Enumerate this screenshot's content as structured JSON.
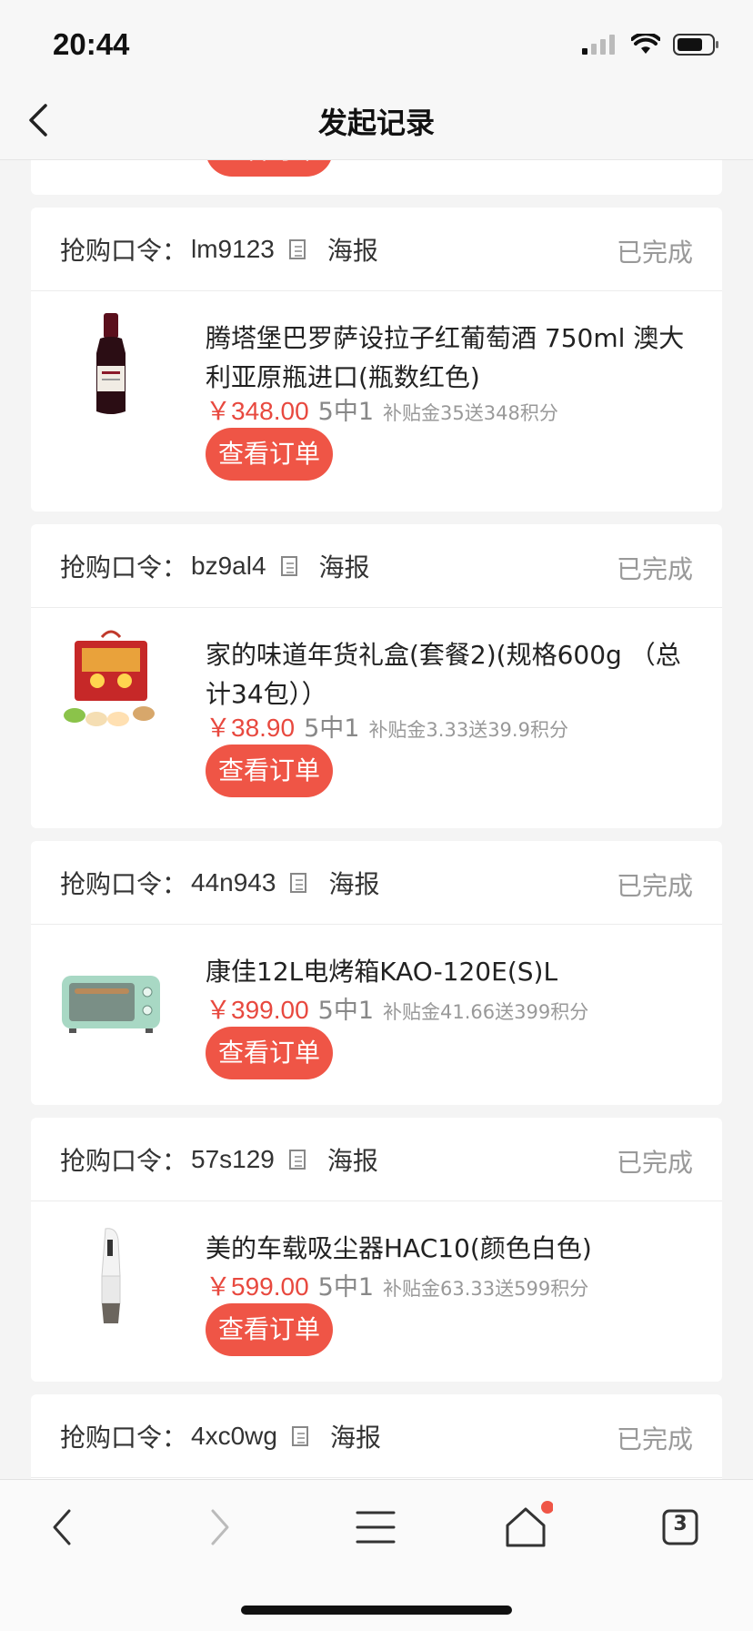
{
  "status_bar": {
    "time": "20:44"
  },
  "nav": {
    "title": "发起记录"
  },
  "common": {
    "code_label": "抢购口令：",
    "poster_label": "海报",
    "order_button": "查看订单"
  },
  "orders": [
    {
      "code": "lm9123",
      "status": "已完成",
      "title": "腾塔堡巴罗萨设拉子红葡萄酒 750ml 澳大利亚原瓶进口(瓶数红色)",
      "price": "￥348.00",
      "odds": "5中1",
      "reward": "补贴金35送348积分",
      "image": "wine-bottle-image"
    },
    {
      "code": "bz9al4",
      "status": "已完成",
      "title": "家的味道年货礼盒(套餐2)(规格600g （总计34包））",
      "price": "￥38.90",
      "odds": "5中1",
      "reward": "补贴金3.33送39.9积分",
      "image": "gift-box-image"
    },
    {
      "code": "44n943",
      "status": "已完成",
      "title": "康佳12L电烤箱KAO-120E(S)L",
      "price": "￥399.00",
      "odds": "5中1",
      "reward": "补贴金41.66送399积分",
      "image": "toaster-oven-image"
    },
    {
      "code": "57s129",
      "status": "已完成",
      "title": "美的车载吸尘器HAC10(颜色白色)",
      "price": "￥599.00",
      "odds": "5中1",
      "reward": "补贴金63.33送599积分",
      "image": "car-vacuum-image"
    },
    {
      "code": "4xc0wg",
      "status": "已完成"
    }
  ],
  "tab_bar": {
    "tabs_count": "3",
    "icons": [
      "back-icon",
      "forward-icon",
      "menu-icon",
      "home-icon",
      "tabs-icon"
    ]
  },
  "colors": {
    "accent": "#ef5546",
    "price": "#e8493f",
    "muted": "#999999"
  }
}
